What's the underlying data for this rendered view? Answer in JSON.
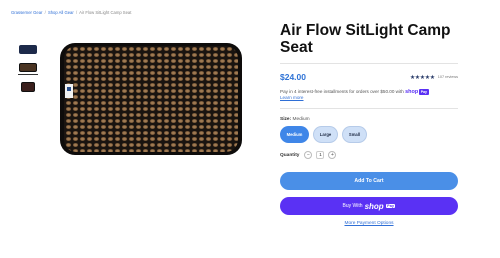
{
  "breadcrumb": {
    "home": "Grasserner Gear",
    "separator": "/",
    "shop": "Shop All Gear",
    "current": "Air Flow SitLight Camp Seat"
  },
  "gallery": {
    "thumbnails": [
      {
        "color": "navy"
      },
      {
        "color": "brown"
      },
      {
        "color": "dark-red"
      }
    ],
    "main_image_label": "Air Flow SitLight Camp Seat photo"
  },
  "product": {
    "title": "Air Flow SitLight Camp Seat",
    "price": "$24.00",
    "stars": "★★★★★",
    "reviews": "107 reviews",
    "installments_text": "Pay in 4 interest-free installments for orders over $50.00 with",
    "shop_word": "shop",
    "pay_word": "Pay",
    "learn_more": "Learn more",
    "size_label": "Size:",
    "size_value": "Medium",
    "sizes": [
      "Medium",
      "Large",
      "Small"
    ],
    "quantity_label": "Quantity",
    "quantity_minus": "−",
    "quantity_value": "1",
    "quantity_plus": "+",
    "add_to_cart": "Add To Cart",
    "buy_with": "Buy With",
    "more_payment": "More Payment Options"
  },
  "colors": {
    "accent_blue": "#4a8fe7",
    "shop_pay_purple": "#5a31f4",
    "price_blue": "#2f73d6"
  }
}
